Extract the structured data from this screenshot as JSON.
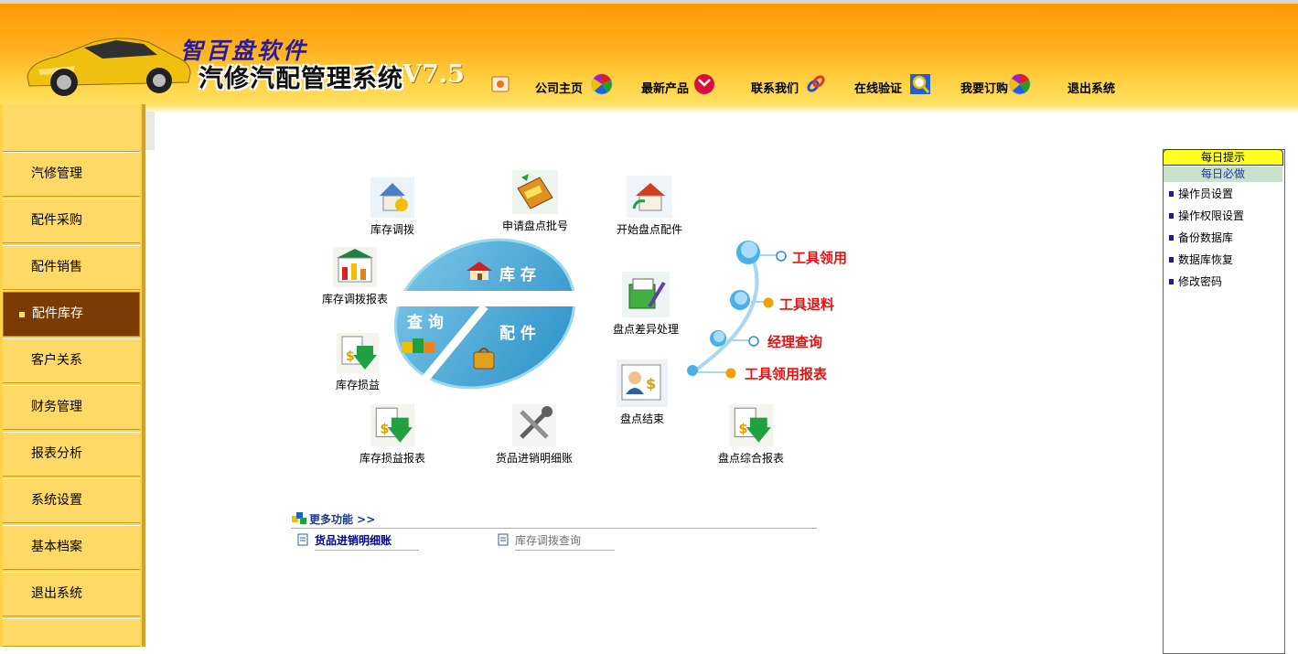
{
  "header": {
    "brand": "智百盘软件",
    "product": "汽修汽配管理系统",
    "version": "V7.5",
    "nav": [
      {
        "label": "公司主页",
        "icon": "colorful-star-icon"
      },
      {
        "label": "最新产品",
        "icon": "red-ball-icon"
      },
      {
        "label": "联系我们",
        "icon": "chain-link-icon"
      },
      {
        "label": "在线验证",
        "icon": "magnifier-icon"
      },
      {
        "label": "我要订购",
        "icon": "colorful-star-icon"
      },
      {
        "label": "退出系统",
        "icon": ""
      }
    ]
  },
  "sidebar": {
    "items": [
      {
        "label": "汽修管理",
        "active": false
      },
      {
        "label": "配件采购",
        "active": false
      },
      {
        "label": "配件销售",
        "active": false
      },
      {
        "label": "配件库存",
        "active": true
      },
      {
        "label": "客户关系",
        "active": false
      },
      {
        "label": "财务管理",
        "active": false
      },
      {
        "label": "报表分析",
        "active": false
      },
      {
        "label": "系统设置",
        "active": false
      },
      {
        "label": "基本档案",
        "active": false
      },
      {
        "label": "退出系统",
        "active": false
      }
    ]
  },
  "diagram": {
    "center": {
      "top": "库 存",
      "left": "查 询",
      "right": "配 件"
    },
    "features": [
      {
        "label": "库存调拨",
        "icon": "house-transfer-icon"
      },
      {
        "label": "申请盘点批号",
        "icon": "tag-icon"
      },
      {
        "label": "开始盘点配件",
        "icon": "house-arrow-icon"
      },
      {
        "label": "库存调拨报表",
        "icon": "bar-chart-icon"
      },
      {
        "label": "盘点差异处理",
        "icon": "edit-box-icon"
      },
      {
        "label": "库存损益",
        "icon": "money-doc-icon"
      },
      {
        "label": "盘点结束",
        "icon": "person-card-icon"
      },
      {
        "label": "库存损益报表",
        "icon": "money-doc-icon"
      },
      {
        "label": "货品进销明细账",
        "icon": "tools-icon"
      },
      {
        "label": "盘点综合报表",
        "icon": "money-doc-icon"
      }
    ],
    "tools": [
      "工具领用",
      "工具退料",
      "经理查询",
      "工具领用报表"
    ]
  },
  "more": {
    "title": "更多功能 >>",
    "links": [
      {
        "label": "货品进销明细账",
        "bold": true
      },
      {
        "label": "库存调拨查询",
        "bold": false
      }
    ]
  },
  "right_panel": {
    "title": "每日提示",
    "subtitle": "每日必做",
    "items": [
      "操作员设置",
      "操作权限设置",
      "备份数据库",
      "数据库恢复",
      "修改密码"
    ]
  }
}
